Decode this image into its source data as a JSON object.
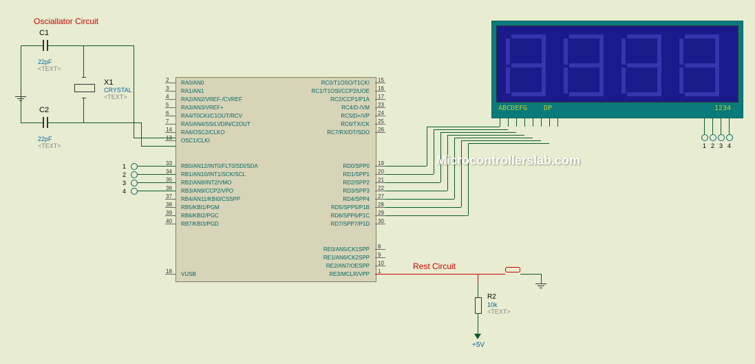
{
  "labels": {
    "osc_title": "Osciallator Circuit",
    "rest_title": "Rest Circuit",
    "c1_ref": "C1",
    "c1_val": "22pF",
    "c1_txt": "<TEXT>",
    "c2_ref": "C2",
    "c2_val": "22pF",
    "c2_txt": "<TEXT>",
    "x1_ref": "X1",
    "x1_val": "CRYSTAL",
    "x1_txt": "<TEXT>",
    "r2_ref": "R2",
    "r2_val": "10k",
    "r2_txt": "<TEXT>",
    "vcc": "+5V",
    "watermark": "Microcontrollerslab.com",
    "disp_left": "ABCDEFG",
    "disp_dp": "DP",
    "disp_right": "1234",
    "portb_nums": [
      "1",
      "2",
      "3",
      "4"
    ],
    "disp_pin_nums": [
      "1",
      "2",
      "3",
      "4"
    ]
  },
  "mcu": {
    "left_pins": [
      {
        "n": "2",
        "name": "RA0/AN0"
      },
      {
        "n": "3",
        "name": "RA1/AN1"
      },
      {
        "n": "4",
        "name": "RA2/AN2/VREF-/CVREF"
      },
      {
        "n": "5",
        "name": "RA3/AN3/VREF+"
      },
      {
        "n": "6",
        "name": "RA4/T0CKI/C1OUT/RCV"
      },
      {
        "n": "7",
        "name": "RA5/AN4/SS/LVDIN/C2OUT"
      },
      {
        "n": "14",
        "name": "RA6/OSC2/CLKO"
      },
      {
        "n": "13",
        "name": "OSC1/CLKI"
      },
      {
        "n": "33",
        "name": "RB0/AN12/INT0/FLT0/SDI/SDA"
      },
      {
        "n": "34",
        "name": "RB1/AN10/INT1/SCK/SCL"
      },
      {
        "n": "35",
        "name": "RB2/AN8/INT2/VMO"
      },
      {
        "n": "36",
        "name": "RB3/AN9/CCP2/VPO"
      },
      {
        "n": "37",
        "name": "RB4/AN11/KBI0/CSSPP"
      },
      {
        "n": "38",
        "name": "RB5/KBI1/PGM"
      },
      {
        "n": "39",
        "name": "RB6/KBI2/PGC"
      },
      {
        "n": "40",
        "name": "RB7/KBI3/PGD"
      },
      {
        "n": "18",
        "name": "VUSB"
      }
    ],
    "right_pins": [
      {
        "n": "15",
        "name": "RC0/T1OSO/T1CKI"
      },
      {
        "n": "16",
        "name": "RC1/T1OSI/CCP2/UOE"
      },
      {
        "n": "17",
        "name": "RC2/CCP1/P1A"
      },
      {
        "n": "23",
        "name": "RC4/D-/VM"
      },
      {
        "n": "24",
        "name": "RC5/D+/VP"
      },
      {
        "n": "25",
        "name": "RC6/TX/CK"
      },
      {
        "n": "26",
        "name": "RC7/RX/DT/SDO"
      },
      {
        "n": "19",
        "name": "RD0/SPP0"
      },
      {
        "n": "20",
        "name": "RD1/SPP1"
      },
      {
        "n": "21",
        "name": "RD2/SPP2"
      },
      {
        "n": "22",
        "name": "RD3/SPP3"
      },
      {
        "n": "27",
        "name": "RD4/SPP4"
      },
      {
        "n": "28",
        "name": "RD5/SPP5/P1B"
      },
      {
        "n": "29",
        "name": "RD6/SPP6/P1C"
      },
      {
        "n": "30",
        "name": "RD7/SPP7/P1D"
      },
      {
        "n": "8",
        "name": "RE0/AN5/CK1SPP"
      },
      {
        "n": "9",
        "name": "RE1/AN6/CK2SPP"
      },
      {
        "n": "10",
        "name": "RE2/AN7/OESPP"
      },
      {
        "n": "1",
        "name": "RE3/MCLR/VPP"
      }
    ]
  }
}
